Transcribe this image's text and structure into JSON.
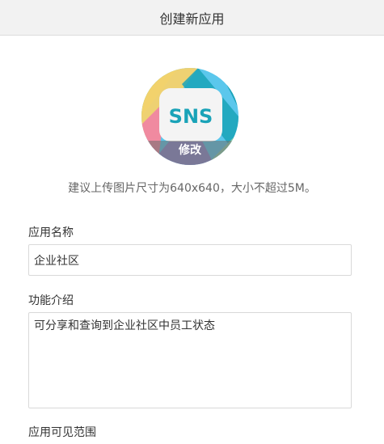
{
  "header": {
    "title": "创建新应用"
  },
  "app_icon": {
    "text": "SNS",
    "edit_label": "修改",
    "colors": {
      "teal": "#1aa3b8",
      "tile": "#f4f4f4",
      "yellow": "#f7d26b",
      "green": "#9fd06e",
      "sky": "#5bc7ec",
      "pink": "#f08aa0",
      "purple": "#8b86c9"
    }
  },
  "upload_hint": "建议上传图片尺寸为640x640，大小不超过5M。",
  "form": {
    "app_name": {
      "label": "应用名称",
      "value": "企业社区"
    },
    "description": {
      "label": "功能介绍",
      "value": "可分享和查询到企业社区中员工状态"
    },
    "visibility": {
      "label": "应用可见范围"
    }
  }
}
